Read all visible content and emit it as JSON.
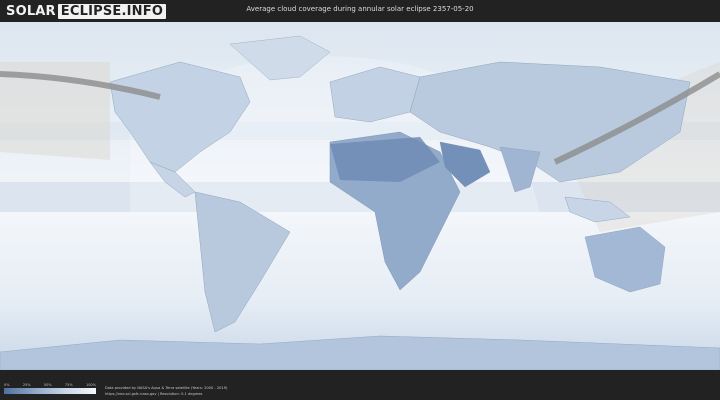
{
  "header": {
    "logo_word1": "SOLAR",
    "logo_word2": "ECLIPSE.INFO",
    "title": "Average cloud coverage during annular solar eclipse 2357-05-20"
  },
  "legend": {
    "ticks": [
      "0%",
      "25%",
      "50%",
      "75%",
      "100%"
    ]
  },
  "credits": {
    "line1": "Data provided by NASA's Aqua & Terra satellite (Years: 2000 - 2019)",
    "line2": "https://neo.sci.gsfc.nasa.gov | Resolution: 0.1 degrees"
  },
  "colors": {
    "clear_sky": "#5a78a6",
    "cloudy": "#f4f7fb",
    "eclipse_path": "#8c8c8c",
    "header_bg": "#222222"
  }
}
